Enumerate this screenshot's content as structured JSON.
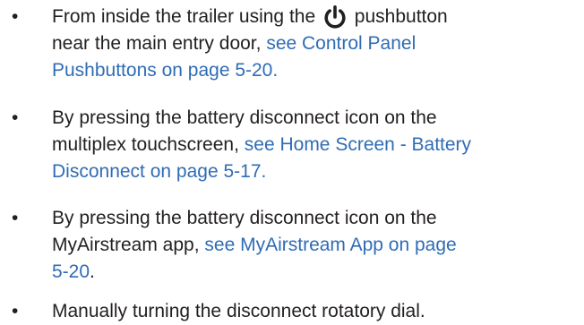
{
  "bullet_char": "•",
  "items": [
    {
      "line1_before": "From inside the trailer using the ",
      "icon": "power-icon",
      "line1_after": " pushbutton",
      "line2": "near the main entry door, ",
      "link1": "see Control Panel",
      "link2": "Pushbuttons on page 5-20."
    },
    {
      "line1": "By pressing the battery disconnect icon on the",
      "line2": "multiplex touchscreen, ",
      "link1": "see Home Screen - Battery",
      "link2": "Disconnect on page 5-17."
    },
    {
      "line1": "By pressing the battery disconnect icon on the",
      "line2": "MyAirstream app, ",
      "link1": "see MyAirstream App on page",
      "link2": "5-20",
      "after": "."
    },
    {
      "line1": "Manually turning the disconnect rotatory dial."
    }
  ]
}
